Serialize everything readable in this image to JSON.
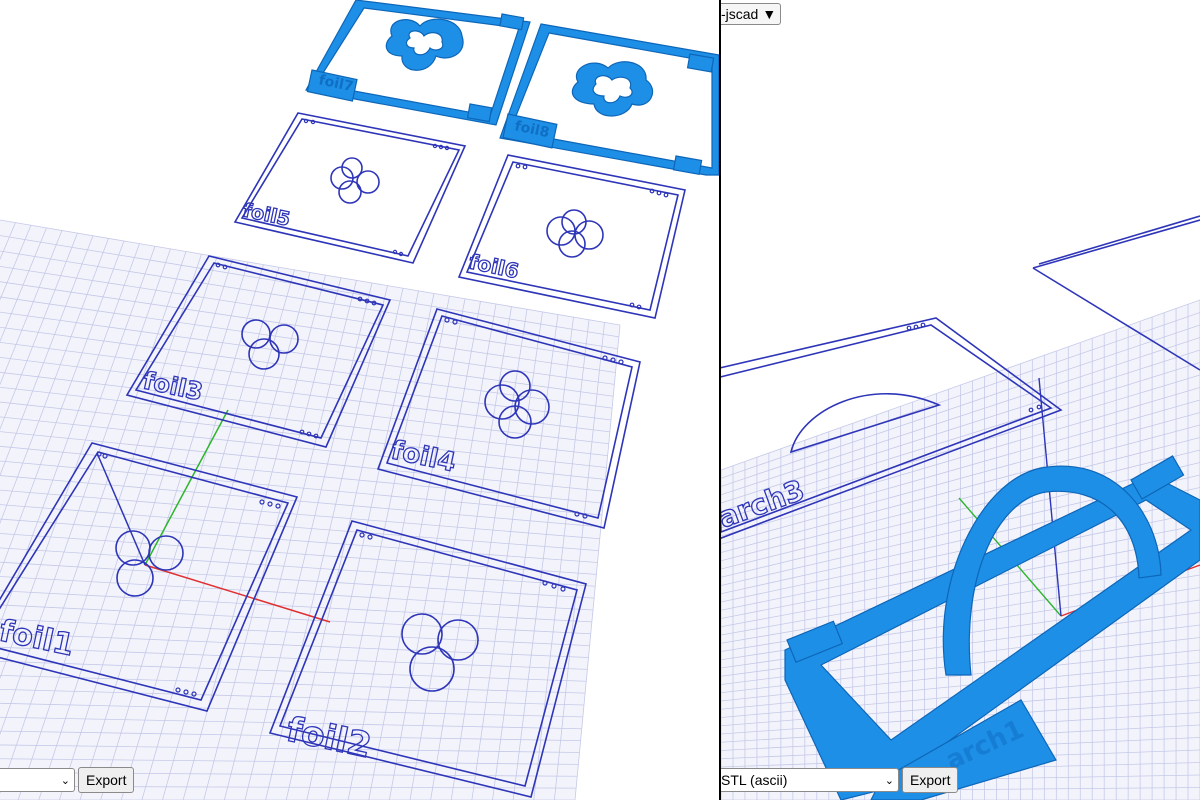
{
  "left_viewer": {
    "format_select": {
      "value": ""
    },
    "export_label": "Export",
    "parts": [
      {
        "name": "foil1",
        "label": "foil1"
      },
      {
        "name": "foil2",
        "label": "foil2"
      },
      {
        "name": "foil3",
        "label": "foil3"
      },
      {
        "name": "foil4",
        "label": "foil4"
      },
      {
        "name": "foil5",
        "label": "foil5"
      },
      {
        "name": "foil6",
        "label": "foil6"
      },
      {
        "name": "foil7",
        "label": "foil7"
      },
      {
        "name": "foil8",
        "label": "foil8"
      }
    ]
  },
  "right_viewer": {
    "dropdown_label": "-jscad",
    "dropdown_arrow": "▼",
    "format_select": {
      "value": "STL (ascii)"
    },
    "export_label": "Export",
    "parts": [
      {
        "name": "arch3",
        "label": "arch3"
      },
      {
        "name": "arch1",
        "label": "arch1"
      }
    ]
  },
  "colors": {
    "wireframe": "#2e35b8",
    "solid": "#1e8fe6",
    "grid": "#c5c9e8",
    "x_axis": "#e03030",
    "y_axis": "#2db52d",
    "z_axis": "#2e35b8",
    "divider": "#000000"
  },
  "icons": {
    "dropdown_arrow": "triangle-down-icon",
    "select_arrow": "chevron-down-icon"
  }
}
